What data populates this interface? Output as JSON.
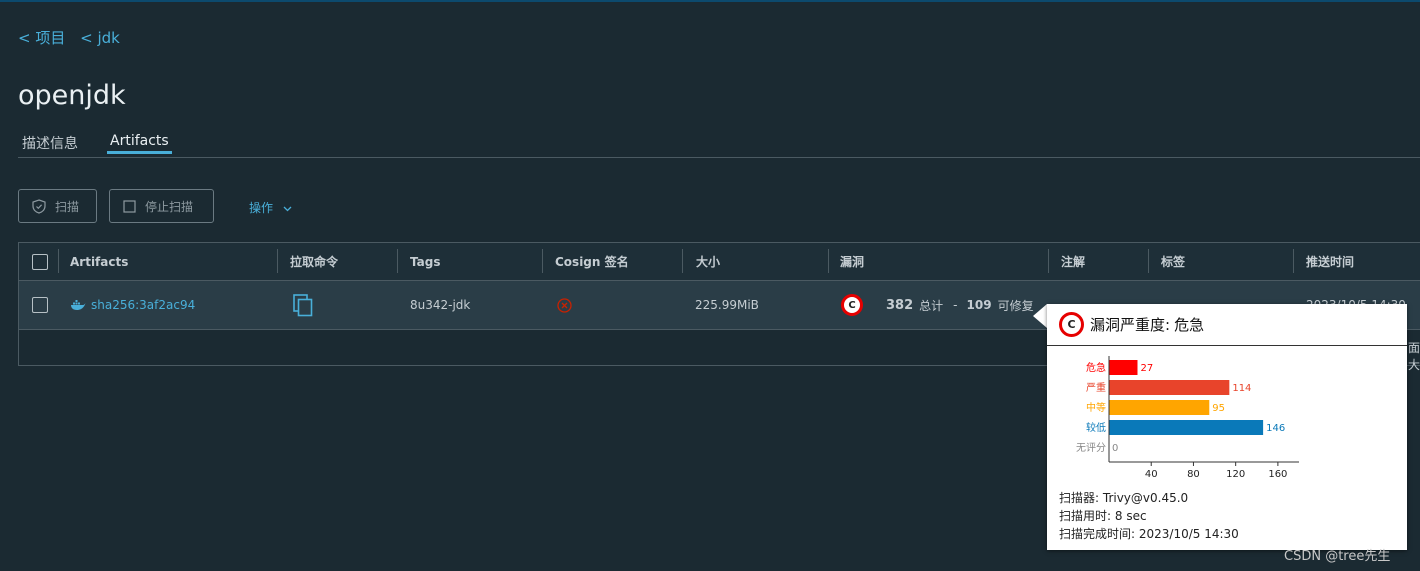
{
  "breadcrumb": {
    "project": "< 项目",
    "repo": "< jdk"
  },
  "page_title": "openjdk",
  "tabs": [
    {
      "label": "描述信息"
    },
    {
      "label": "Artifacts"
    }
  ],
  "toolbar": {
    "scan_label": "扫描",
    "stop_scan_label": "停止扫描",
    "actions_label": "操作"
  },
  "table": {
    "headers": [
      "Artifacts",
      "拉取命令",
      "Tags",
      "Cosign 签名",
      "大小",
      "漏洞",
      "注解",
      "标签",
      "推送时间"
    ],
    "rows": [
      {
        "artifact": "sha256:3af2ac94",
        "tag": "8u342-jdk",
        "size": "225.99MiB",
        "vuln_badge": "C",
        "vuln_total": "382",
        "vuln_total_label": "总计",
        "vuln_sep": "-",
        "vuln_fixable": "109",
        "vuln_fixable_label": "可修复",
        "push_time": "2023/10/5 14:30"
      }
    ],
    "overflow_text": "面大"
  },
  "popup": {
    "badge": "C",
    "title_prefix": "漏洞严重度:",
    "title_severity": "危急",
    "scanner_label": "扫描器:",
    "scanner_value": "Trivy@v0.45.0",
    "duration_label": "扫描用时:",
    "duration_value": "8 sec",
    "completed_label": "扫描完成时间:",
    "completed_value": "2023/10/5 14:30"
  },
  "chart_data": {
    "type": "bar",
    "orientation": "horizontal",
    "categories": [
      "危急",
      "严重",
      "中等",
      "较低",
      "无评分"
    ],
    "values": [
      27,
      114,
      95,
      146,
      0
    ],
    "colors": [
      "#ff0000",
      "#e8442b",
      "#ffa500",
      "#0a79b9",
      "#888888"
    ],
    "xlim": [
      0,
      180
    ],
    "xticks": [
      40,
      80,
      120,
      160
    ],
    "xlabel": "",
    "ylabel": ""
  },
  "watermark": "CSDN @tree先生",
  "colors": {
    "accent": "#49afd9",
    "background": "#1b2a32",
    "critical": "#e60000"
  }
}
